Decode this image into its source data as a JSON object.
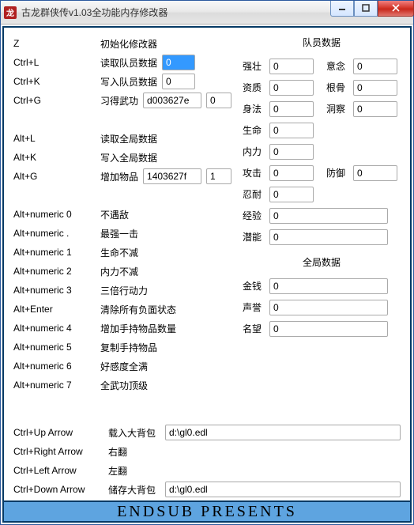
{
  "window": {
    "title": "古龙群侠传v1.03全功能内存修改器"
  },
  "left": {
    "col1": "Z",
    "header": "初始化修改器",
    "rows": [
      {
        "hot": "Ctrl+L",
        "label": "读取队员数据",
        "input1": "0",
        "in1w": 42,
        "selected": true
      },
      {
        "hot": "Ctrl+K",
        "label": "写入队员数据",
        "input1": "0",
        "in1w": 42
      },
      {
        "hot": "Ctrl+G",
        "label": "习得武功",
        "input1": "d003627e",
        "in1w": 74,
        "input2": "0",
        "in2w": 32
      },
      {
        "hot": "",
        "label": ""
      },
      {
        "hot": "Alt+L",
        "label": "读取全局数据"
      },
      {
        "hot": "Alt+K",
        "label": "写入全局数据"
      },
      {
        "hot": "Alt+G",
        "label": "增加物品",
        "input1": "1403627f",
        "in1w": 74,
        "input2": "1",
        "in2w": 32
      },
      {
        "hot": "",
        "label": ""
      },
      {
        "hot": "Alt+numeric 0",
        "label": "不遇敌"
      },
      {
        "hot": "Alt+numeric .",
        "label": "最强一击"
      },
      {
        "hot": "Alt+numeric 1",
        "label": "生命不减"
      },
      {
        "hot": "Alt+numeric 2",
        "label": "内力不减"
      },
      {
        "hot": "Alt+numeric 3",
        "label": "三倍行动力"
      },
      {
        "hot": "Alt+Enter",
        "label": "清除所有负面状态"
      },
      {
        "hot": "Alt+numeric 4",
        "label": "增加手持物品数量"
      },
      {
        "hot": "Alt+numeric 5",
        "label": "复制手持物品"
      },
      {
        "hot": "Alt+numeric 6",
        "label": "好感度全满"
      },
      {
        "hot": "Alt+numeric 7",
        "label": "全武功顶级"
      }
    ]
  },
  "right": {
    "header1": "队员数据",
    "pairs": [
      [
        "强壮",
        "0",
        "意念",
        "0"
      ],
      [
        "资质",
        "0",
        "根骨",
        "0"
      ],
      [
        "身法",
        "0",
        "洞察",
        "0"
      ],
      [
        "生命",
        "0",
        "",
        ""
      ],
      [
        "内力",
        "0",
        "",
        ""
      ],
      [
        "攻击",
        "0",
        "防御",
        "0"
      ],
      [
        "忍耐",
        "0",
        "",
        ""
      ],
      [
        "经验",
        "0",
        "",
        ""
      ],
      [
        "潜能",
        "0",
        "",
        ""
      ]
    ],
    "header2": "全局数据",
    "globals": [
      [
        "金钱",
        "0"
      ],
      [
        "声誉",
        "0"
      ],
      [
        "名望",
        "0"
      ]
    ]
  },
  "bottom": [
    {
      "hot": "Ctrl+Up Arrow",
      "label": "载入大背包",
      "value": "d:\\gl0.edl"
    },
    {
      "hot": "Ctrl+Right Arrow",
      "label": "右翻"
    },
    {
      "hot": "Ctrl+Left Arrow",
      "label": "左翻"
    },
    {
      "hot": "Ctrl+Down Arrow",
      "label": "储存大背包",
      "value": "d:\\gl0.edl"
    }
  ],
  "footer": "ENDSUB PRESENTS"
}
